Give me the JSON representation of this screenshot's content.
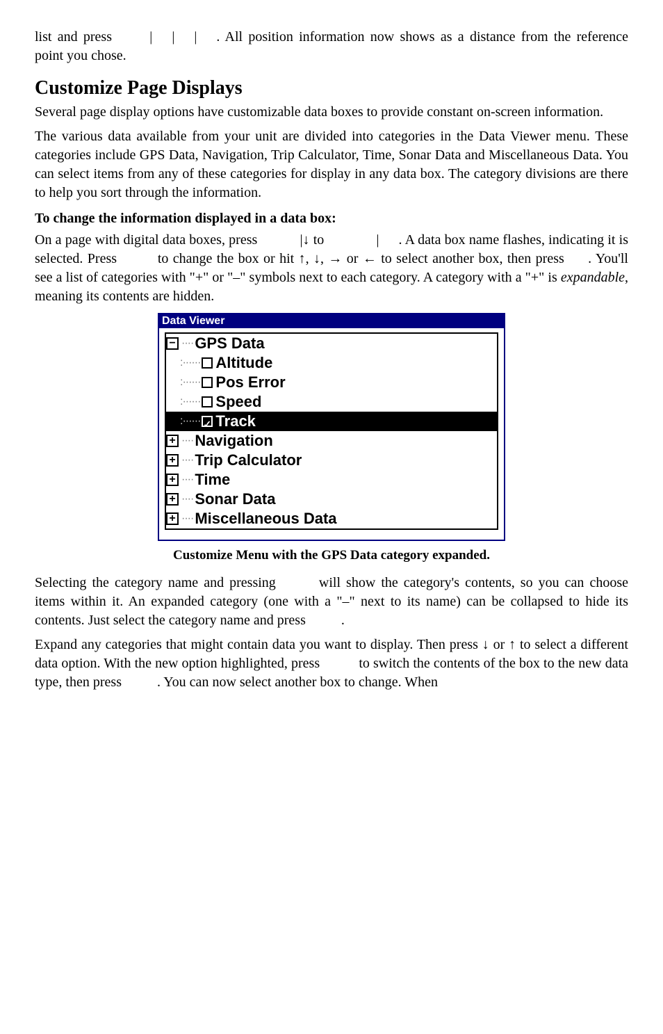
{
  "p1_a": "list and press ",
  "p1_b": ". All position information now shows as a distance from the reference point you chose.",
  "h_customize": "Customize Page Displays",
  "p2": "Several page display options have customizable data boxes to provide constant on-screen information.",
  "p3": "The various data available from your unit are divided into categories in the Data Viewer menu. These categories include GPS Data, Navigation, Trip Calculator, Time, Sonar Data and Miscellaneous Data. You can select items from any of these categories for display in any data box. The category divisions are there to help you sort through the information.",
  "sub1": "To change the information displayed in a data box:",
  "p4_a": "On a page with digital data boxes, press ",
  "p4_b": "|↓ to ",
  "p4_c": "|",
  "p4_d": ". A data box name flashes, indicating it is selected. Press ",
  "p4_e": " to change the box or hit ↑, ↓, → or ← to select another box, then press ",
  "p4_f": ". You'll see a list of categories with \"+\" or \"–\" symbols next to each category. A category with a \"+\" is ",
  "p4_g": "expandable",
  "p4_h": ", meaning its contents are hidden.",
  "viewer": {
    "title": "Data Viewer",
    "cat_gps": "GPS Data",
    "gps_children": [
      "Altitude",
      "Pos Error",
      "Speed",
      "Track"
    ],
    "cat_nav": "Navigation",
    "cat_trip": "Trip Calculator",
    "cat_time": "Time",
    "cat_sonar": "Sonar Data",
    "cat_misc": "Miscellaneous Data"
  },
  "caption": "Customize Menu with the GPS Data category expanded.",
  "p5_a": "Selecting the category name and pressing ",
  "p5_b": " will show the category's contents, so you can choose items within it. An expanded category (one with a \"–\" next to its name) can be collapsed to hide its contents. Just select the category name and press ",
  "p5_c": ".",
  "p6_a": "Expand any categories that might contain data you want to display. Then press ↓ or ↑ to select a different data option. With the new option highlighted, press ",
  "p6_b": " to switch the contents of the box to the new data type, then press ",
  "p6_c": ". You can now select another box to change. When"
}
